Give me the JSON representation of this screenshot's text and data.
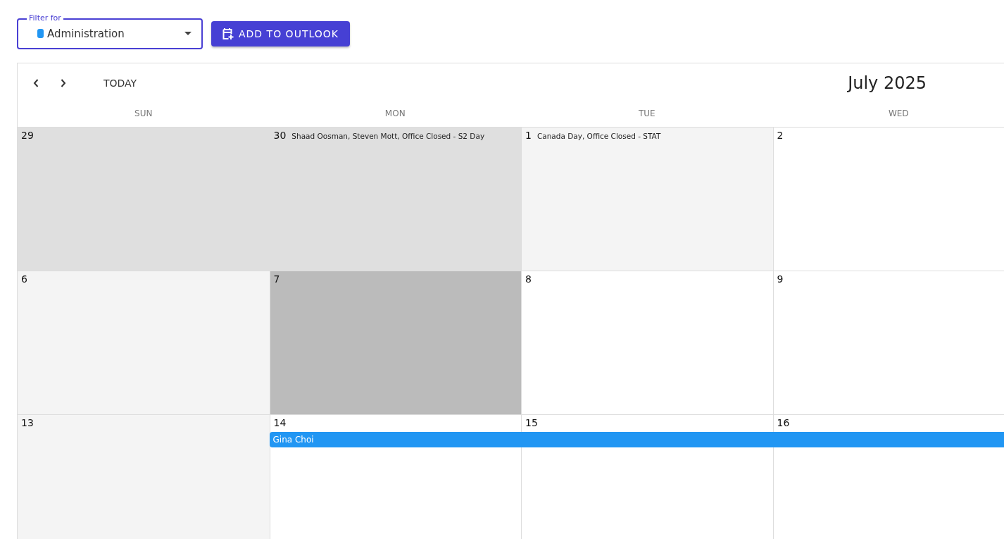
{
  "filter": {
    "label": "Filter for",
    "value": "Administration",
    "color": "#2196f3"
  },
  "outlook_button": {
    "label": "ADD TO OUTLOOK"
  },
  "calendar": {
    "today_label": "TODAY",
    "title": "July 2025",
    "weekdays": [
      "SUN",
      "MON",
      "TUE",
      "WED"
    ],
    "weeks": [
      {
        "days": [
          {
            "number": "29",
            "kind": "outside"
          },
          {
            "number": "30",
            "kind": "outside",
            "note": "Shaad Oosman, Steven Mott, Office Closed - S2 Day"
          },
          {
            "number": "1",
            "kind": "holiday",
            "note": "Canada Day, Office Closed - STAT"
          },
          {
            "number": "2",
            "kind": "normal"
          }
        ]
      },
      {
        "days": [
          {
            "number": "6",
            "kind": "weekend"
          },
          {
            "number": "7",
            "kind": "selected"
          },
          {
            "number": "8",
            "kind": "normal"
          },
          {
            "number": "9",
            "kind": "normal"
          }
        ]
      },
      {
        "days": [
          {
            "number": "13",
            "kind": "weekend"
          },
          {
            "number": "14",
            "kind": "normal",
            "event": {
              "title": "Gina Choi",
              "color": "#2196f3"
            }
          },
          {
            "number": "15",
            "kind": "normal"
          },
          {
            "number": "16",
            "kind": "normal"
          }
        ]
      }
    ]
  }
}
